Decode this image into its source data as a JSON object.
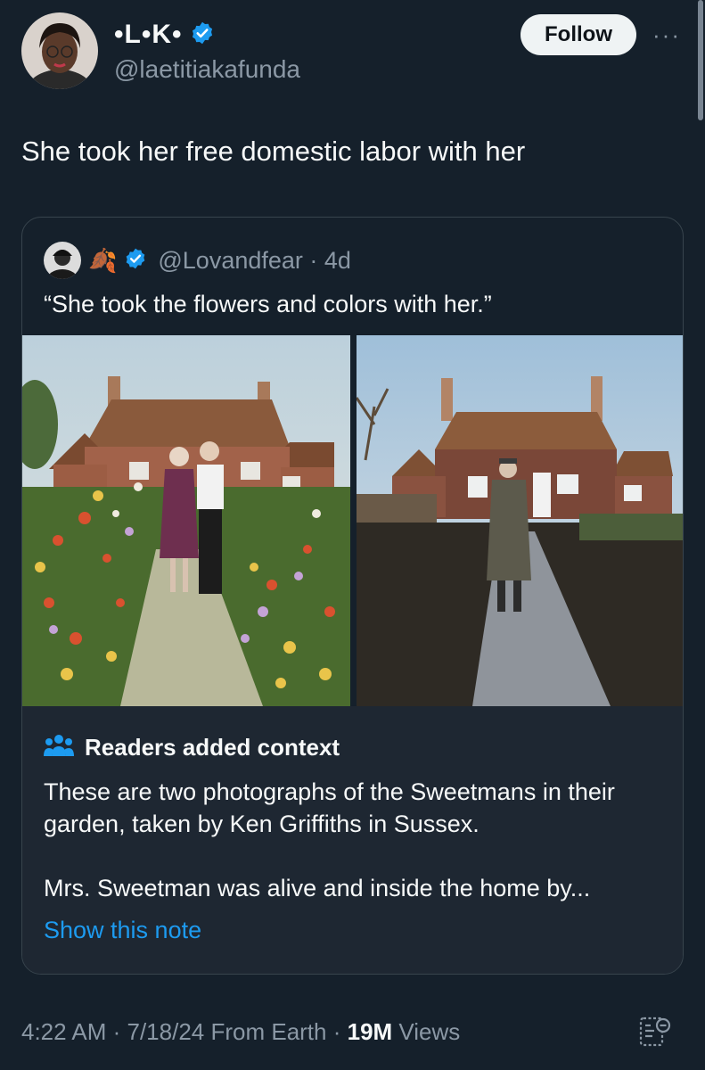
{
  "author": {
    "display_name": "•L•K•",
    "handle": "@laetitiakafunda",
    "verified": true
  },
  "buttons": {
    "follow_label": "Follow",
    "more_label": "···"
  },
  "tweet": {
    "text": "She took her free domestic labor with her"
  },
  "quoted": {
    "emoji": "🍂",
    "handle_time": "@Lovandfear · 4d",
    "text": "“She took the flowers and colors with her.”"
  },
  "context": {
    "title": "Readers added context",
    "paragraph1": "These are two photographs of the Sweetmans in their garden, taken by Ken Griffiths in Sussex.",
    "paragraph2": "Mrs. Sweetman was alive and inside the home by...",
    "link_label": "Show this note"
  },
  "meta": {
    "time_date": "4:22 AM · 7/18/24 From Earth · ",
    "views_count": "19M",
    "views_label": " Views"
  },
  "colors": {
    "background": "#15202b",
    "accent": "#1d9bf0",
    "secondary_text": "#8b98a5",
    "context_bg": "#1e2732"
  },
  "icons": {
    "verified": "verified-badge-icon",
    "more": "more-icon",
    "readers": "people-icon",
    "bookmark": "bookmark-icon"
  }
}
